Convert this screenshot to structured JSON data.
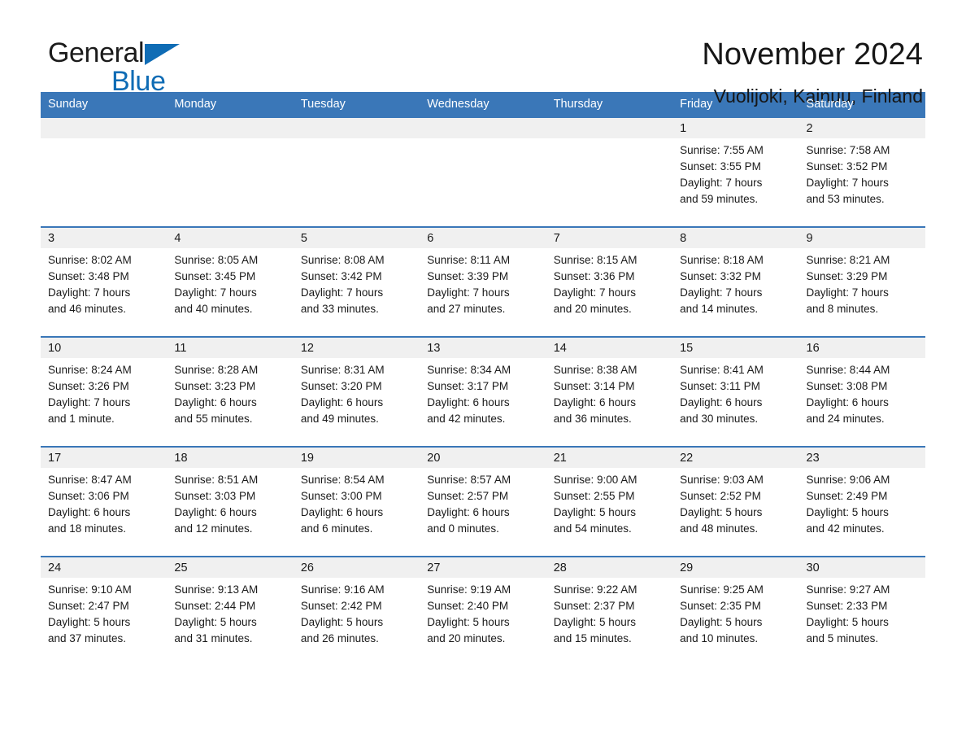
{
  "brand": {
    "name_part1": "General",
    "name_part2": "Blue",
    "triangle_color": "#0f6cb5"
  },
  "header": {
    "title": "November 2024",
    "subtitle": "Vuolijoki, Kainuu, Finland"
  },
  "theme": {
    "header_blue": "#3a77b8",
    "day_band_gray": "#f0f0f0",
    "text_color": "#1a1a1a",
    "page_background": "#ffffff"
  },
  "calendar": {
    "weekdays": [
      "Sunday",
      "Monday",
      "Tuesday",
      "Wednesday",
      "Thursday",
      "Friday",
      "Saturday"
    ],
    "weeks": [
      [
        {
          "day": "",
          "blank": true,
          "sunrise": "",
          "sunset": "",
          "daylight1": "",
          "daylight2": ""
        },
        {
          "day": "",
          "blank": true,
          "sunrise": "",
          "sunset": "",
          "daylight1": "",
          "daylight2": ""
        },
        {
          "day": "",
          "blank": true,
          "sunrise": "",
          "sunset": "",
          "daylight1": "",
          "daylight2": ""
        },
        {
          "day": "",
          "blank": true,
          "sunrise": "",
          "sunset": "",
          "daylight1": "",
          "daylight2": ""
        },
        {
          "day": "",
          "blank": true,
          "sunrise": "",
          "sunset": "",
          "daylight1": "",
          "daylight2": ""
        },
        {
          "day": "1",
          "sunrise": "Sunrise: 7:55 AM",
          "sunset": "Sunset: 3:55 PM",
          "daylight1": "Daylight: 7 hours",
          "daylight2": "and 59 minutes."
        },
        {
          "day": "2",
          "sunrise": "Sunrise: 7:58 AM",
          "sunset": "Sunset: 3:52 PM",
          "daylight1": "Daylight: 7 hours",
          "daylight2": "and 53 minutes."
        }
      ],
      [
        {
          "day": "3",
          "sunrise": "Sunrise: 8:02 AM",
          "sunset": "Sunset: 3:48 PM",
          "daylight1": "Daylight: 7 hours",
          "daylight2": "and 46 minutes."
        },
        {
          "day": "4",
          "sunrise": "Sunrise: 8:05 AM",
          "sunset": "Sunset: 3:45 PM",
          "daylight1": "Daylight: 7 hours",
          "daylight2": "and 40 minutes."
        },
        {
          "day": "5",
          "sunrise": "Sunrise: 8:08 AM",
          "sunset": "Sunset: 3:42 PM",
          "daylight1": "Daylight: 7 hours",
          "daylight2": "and 33 minutes."
        },
        {
          "day": "6",
          "sunrise": "Sunrise: 8:11 AM",
          "sunset": "Sunset: 3:39 PM",
          "daylight1": "Daylight: 7 hours",
          "daylight2": "and 27 minutes."
        },
        {
          "day": "7",
          "sunrise": "Sunrise: 8:15 AM",
          "sunset": "Sunset: 3:36 PM",
          "daylight1": "Daylight: 7 hours",
          "daylight2": "and 20 minutes."
        },
        {
          "day": "8",
          "sunrise": "Sunrise: 8:18 AM",
          "sunset": "Sunset: 3:32 PM",
          "daylight1": "Daylight: 7 hours",
          "daylight2": "and 14 minutes."
        },
        {
          "day": "9",
          "sunrise": "Sunrise: 8:21 AM",
          "sunset": "Sunset: 3:29 PM",
          "daylight1": "Daylight: 7 hours",
          "daylight2": "and 8 minutes."
        }
      ],
      [
        {
          "day": "10",
          "sunrise": "Sunrise: 8:24 AM",
          "sunset": "Sunset: 3:26 PM",
          "daylight1": "Daylight: 7 hours",
          "daylight2": "and 1 minute."
        },
        {
          "day": "11",
          "sunrise": "Sunrise: 8:28 AM",
          "sunset": "Sunset: 3:23 PM",
          "daylight1": "Daylight: 6 hours",
          "daylight2": "and 55 minutes."
        },
        {
          "day": "12",
          "sunrise": "Sunrise: 8:31 AM",
          "sunset": "Sunset: 3:20 PM",
          "daylight1": "Daylight: 6 hours",
          "daylight2": "and 49 minutes."
        },
        {
          "day": "13",
          "sunrise": "Sunrise: 8:34 AM",
          "sunset": "Sunset: 3:17 PM",
          "daylight1": "Daylight: 6 hours",
          "daylight2": "and 42 minutes."
        },
        {
          "day": "14",
          "sunrise": "Sunrise: 8:38 AM",
          "sunset": "Sunset: 3:14 PM",
          "daylight1": "Daylight: 6 hours",
          "daylight2": "and 36 minutes."
        },
        {
          "day": "15",
          "sunrise": "Sunrise: 8:41 AM",
          "sunset": "Sunset: 3:11 PM",
          "daylight1": "Daylight: 6 hours",
          "daylight2": "and 30 minutes."
        },
        {
          "day": "16",
          "sunrise": "Sunrise: 8:44 AM",
          "sunset": "Sunset: 3:08 PM",
          "daylight1": "Daylight: 6 hours",
          "daylight2": "and 24 minutes."
        }
      ],
      [
        {
          "day": "17",
          "sunrise": "Sunrise: 8:47 AM",
          "sunset": "Sunset: 3:06 PM",
          "daylight1": "Daylight: 6 hours",
          "daylight2": "and 18 minutes."
        },
        {
          "day": "18",
          "sunrise": "Sunrise: 8:51 AM",
          "sunset": "Sunset: 3:03 PM",
          "daylight1": "Daylight: 6 hours",
          "daylight2": "and 12 minutes."
        },
        {
          "day": "19",
          "sunrise": "Sunrise: 8:54 AM",
          "sunset": "Sunset: 3:00 PM",
          "daylight1": "Daylight: 6 hours",
          "daylight2": "and 6 minutes."
        },
        {
          "day": "20",
          "sunrise": "Sunrise: 8:57 AM",
          "sunset": "Sunset: 2:57 PM",
          "daylight1": "Daylight: 6 hours",
          "daylight2": "and 0 minutes."
        },
        {
          "day": "21",
          "sunrise": "Sunrise: 9:00 AM",
          "sunset": "Sunset: 2:55 PM",
          "daylight1": "Daylight: 5 hours",
          "daylight2": "and 54 minutes."
        },
        {
          "day": "22",
          "sunrise": "Sunrise: 9:03 AM",
          "sunset": "Sunset: 2:52 PM",
          "daylight1": "Daylight: 5 hours",
          "daylight2": "and 48 minutes."
        },
        {
          "day": "23",
          "sunrise": "Sunrise: 9:06 AM",
          "sunset": "Sunset: 2:49 PM",
          "daylight1": "Daylight: 5 hours",
          "daylight2": "and 42 minutes."
        }
      ],
      [
        {
          "day": "24",
          "sunrise": "Sunrise: 9:10 AM",
          "sunset": "Sunset: 2:47 PM",
          "daylight1": "Daylight: 5 hours",
          "daylight2": "and 37 minutes."
        },
        {
          "day": "25",
          "sunrise": "Sunrise: 9:13 AM",
          "sunset": "Sunset: 2:44 PM",
          "daylight1": "Daylight: 5 hours",
          "daylight2": "and 31 minutes."
        },
        {
          "day": "26",
          "sunrise": "Sunrise: 9:16 AM",
          "sunset": "Sunset: 2:42 PM",
          "daylight1": "Daylight: 5 hours",
          "daylight2": "and 26 minutes."
        },
        {
          "day": "27",
          "sunrise": "Sunrise: 9:19 AM",
          "sunset": "Sunset: 2:40 PM",
          "daylight1": "Daylight: 5 hours",
          "daylight2": "and 20 minutes."
        },
        {
          "day": "28",
          "sunrise": "Sunrise: 9:22 AM",
          "sunset": "Sunset: 2:37 PM",
          "daylight1": "Daylight: 5 hours",
          "daylight2": "and 15 minutes."
        },
        {
          "day": "29",
          "sunrise": "Sunrise: 9:25 AM",
          "sunset": "Sunset: 2:35 PM",
          "daylight1": "Daylight: 5 hours",
          "daylight2": "and 10 minutes."
        },
        {
          "day": "30",
          "sunrise": "Sunrise: 9:27 AM",
          "sunset": "Sunset: 2:33 PM",
          "daylight1": "Daylight: 5 hours",
          "daylight2": "and 5 minutes."
        }
      ]
    ]
  }
}
